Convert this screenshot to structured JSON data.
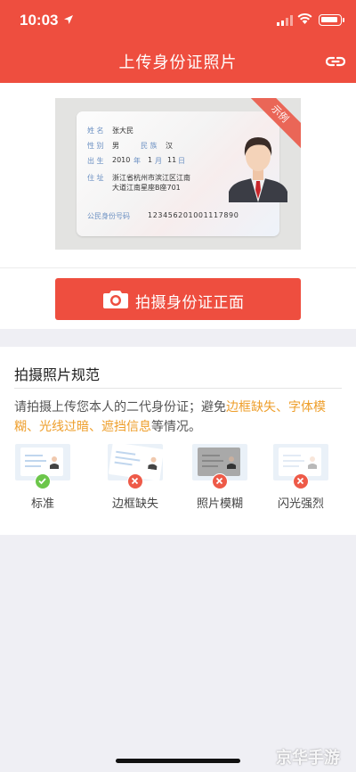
{
  "status_bar": {
    "time": "10:03"
  },
  "header": {
    "title": "上传身份证照片"
  },
  "sample": {
    "badge": "示例",
    "fields": {
      "name_label": "姓 名",
      "name_value": "张大民",
      "sex_label": "性 别",
      "sex_value": "男",
      "ethnicity_label": "民 族",
      "ethnicity_value": "汉",
      "birth_label": "出 生",
      "birth_year": "2010",
      "year_unit": "年",
      "birth_month": "1",
      "month_unit": "月",
      "birth_day": "11",
      "day_unit": "日",
      "address_label": "住 址",
      "address_line1": "浙江省杭州市滨江区江南",
      "address_line2": "大道江南星座B座701",
      "id_label": "公民身份号码",
      "id_value": "123456201001117890"
    }
  },
  "shoot_button": {
    "label": "拍摄身份证正面"
  },
  "spec": {
    "title": "拍摄照片规范",
    "desc_prefix": "请拍摄上传您本人的二代身份证；避免",
    "desc_highlight": "边框缺失、字体模糊、光线过暗、遮挡信息",
    "desc_suffix": "等情况。",
    "examples": [
      {
        "label": "标准",
        "ok": true
      },
      {
        "label": "边框缺失",
        "ok": false
      },
      {
        "label": "照片模糊",
        "ok": false
      },
      {
        "label": "闪光强烈",
        "ok": false
      }
    ]
  },
  "watermark": "京华手游",
  "colors": {
    "brand": "#ee4e3f",
    "highlight": "#ee9e2a",
    "ok": "#6cc64a",
    "bad": "#ee5a48"
  },
  "icons": [
    "location-arrow-icon",
    "signal-icon",
    "wifi-icon",
    "battery-icon",
    "link-icon",
    "camera-icon",
    "check-icon",
    "cross-icon"
  ]
}
